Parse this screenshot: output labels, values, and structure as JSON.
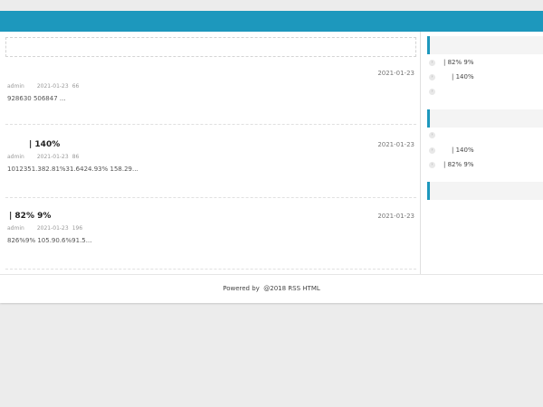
{
  "posts": [
    {
      "title": "",
      "date": "2021-01-23",
      "author": "admin",
      "meta_date": "2021-01-23",
      "views": "66",
      "excerpt": "928630 506847 ..."
    },
    {
      "title": "| 140%",
      "date": "2021-01-23",
      "author": "admin",
      "meta_date": "2021-01-23",
      "views": "86",
      "excerpt": "1012351.382.81%31.6424.93% 158.29..."
    },
    {
      "title": "| 82% 9%",
      "date": "2021-01-23",
      "author": "admin",
      "meta_date": "2021-01-23",
      "views": "196",
      "excerpt": "826%9% 105.90.6%91.5..."
    }
  ],
  "sidebar": {
    "widget1": {
      "title": "",
      "items": [
        "| 82% 9%",
        "| 140%",
        ""
      ]
    },
    "widget2": {
      "title": "",
      "items": [
        "",
        "| 140%",
        "| 82% 9%"
      ]
    },
    "widget3": {
      "title": ""
    }
  },
  "footer": {
    "powered_label": "Powered by",
    "copyright": "@2018 RSS HTML"
  },
  "colors": {
    "accent": "#1d98bd",
    "background": "#ececec"
  }
}
